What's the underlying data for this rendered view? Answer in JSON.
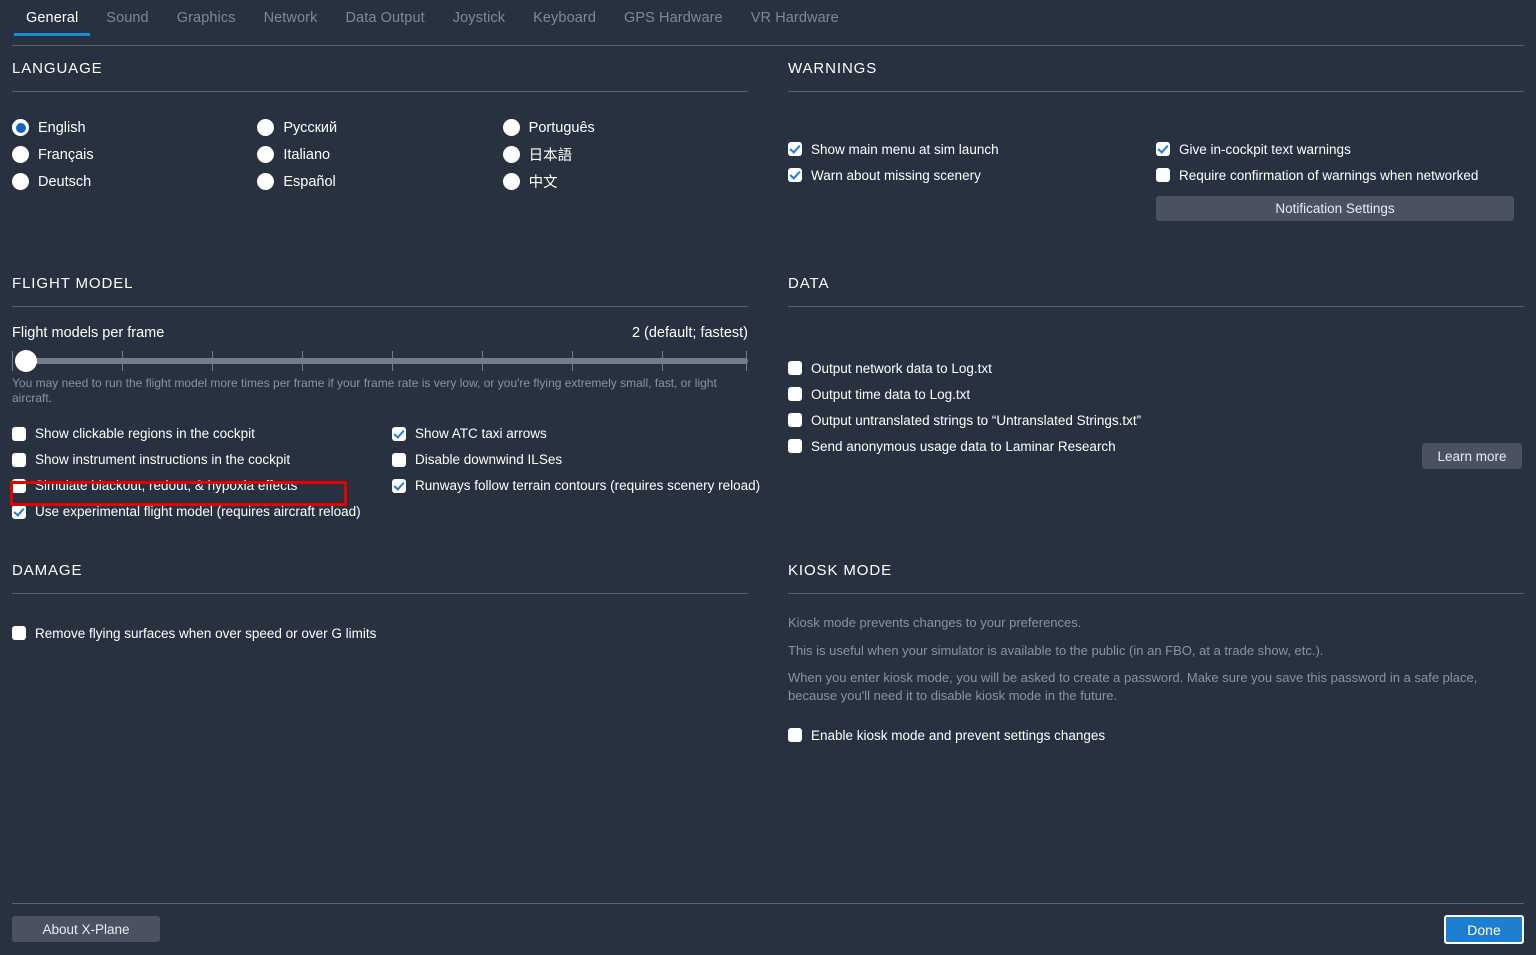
{
  "tabs": [
    {
      "label": "General",
      "active": true
    },
    {
      "label": "Sound",
      "active": false
    },
    {
      "label": "Graphics",
      "active": false
    },
    {
      "label": "Network",
      "active": false
    },
    {
      "label": "Data Output",
      "active": false
    },
    {
      "label": "Joystick",
      "active": false
    },
    {
      "label": "Keyboard",
      "active": false
    },
    {
      "label": "GPS Hardware",
      "active": false
    },
    {
      "label": "VR Hardware",
      "active": false
    }
  ],
  "language": {
    "title": "LANGUAGE",
    "columns": [
      [
        {
          "label": "English",
          "selected": true
        },
        {
          "label": "Français",
          "selected": false
        },
        {
          "label": "Deutsch",
          "selected": false
        }
      ],
      [
        {
          "label": "Русский",
          "selected": false
        },
        {
          "label": "Italiano",
          "selected": false
        },
        {
          "label": "Español",
          "selected": false
        }
      ],
      [
        {
          "label": "Português",
          "selected": false
        },
        {
          "label": "日本語",
          "selected": false
        },
        {
          "label": "中文",
          "selected": false
        }
      ]
    ]
  },
  "warnings": {
    "title": "WARNINGS",
    "left": [
      {
        "label": "Show main menu at sim launch",
        "checked": true
      },
      {
        "label": "Warn about missing scenery",
        "checked": true
      }
    ],
    "right": [
      {
        "label": "Give in-cockpit text warnings",
        "checked": true
      },
      {
        "label": "Require confirmation of warnings when networked",
        "checked": false
      }
    ],
    "notification_settings_label": "Notification Settings"
  },
  "flight_model": {
    "title": "FLIGHT MODEL",
    "slider_label": "Flight models per frame",
    "slider_value_text": "2 (default; fastest)",
    "slider_position_percent": 0,
    "slider_ticks": 8,
    "note": "You may need to run the flight model more times per frame if your frame rate is very low, or you're flying extremely small, fast, or light aircraft.",
    "left": [
      {
        "label": "Show clickable regions in the cockpit",
        "checked": false
      },
      {
        "label": "Show instrument instructions in the cockpit",
        "checked": false
      },
      {
        "label": "Simulate blackout, redout, & hypoxia effects",
        "checked": false
      },
      {
        "label": "Use experimental flight model (requires aircraft reload)",
        "checked": true,
        "highlighted": true
      }
    ],
    "right": [
      {
        "label": "Show ATC taxi arrows",
        "checked": true
      },
      {
        "label": "Disable downwind ILSes",
        "checked": false
      },
      {
        "label": "Runways follow terrain contours (requires scenery reload)",
        "checked": true
      }
    ]
  },
  "data": {
    "title": "DATA",
    "items": [
      {
        "label": "Output network data to Log.txt",
        "checked": false
      },
      {
        "label": "Output time data to Log.txt",
        "checked": false
      },
      {
        "label": "Output untranslated strings to “Untranslated Strings.txt”",
        "checked": false
      },
      {
        "label": "Send anonymous usage data to Laminar Research",
        "checked": false
      }
    ],
    "learn_more_label": "Learn more"
  },
  "damage": {
    "title": "DAMAGE",
    "items": [
      {
        "label": "Remove flying surfaces when over speed or over G limits",
        "checked": false
      }
    ]
  },
  "kiosk": {
    "title": "KIOSK MODE",
    "paragraphs": [
      "Kiosk mode prevents changes to your preferences.",
      "This is useful when your simulator is available to the public (in an FBO, at a trade show, etc.).",
      "When you enter kiosk mode, you will be asked to create a password. Make sure you save this password in a safe place, because you'll need it to disable kiosk mode in the future."
    ],
    "enable": {
      "label": "Enable kiosk mode and prevent settings changes",
      "checked": false
    }
  },
  "footer": {
    "about_label": "About X-Plane",
    "done_label": "Done"
  },
  "colors": {
    "background": "#283140",
    "accent_blue": "#1e8ad6",
    "done_blue": "#1e7fd0",
    "highlight_red": "#e70000",
    "muted_text": "#8a93a3",
    "inactive_tab": "#7d8899",
    "button_gray": "#4a5160"
  }
}
